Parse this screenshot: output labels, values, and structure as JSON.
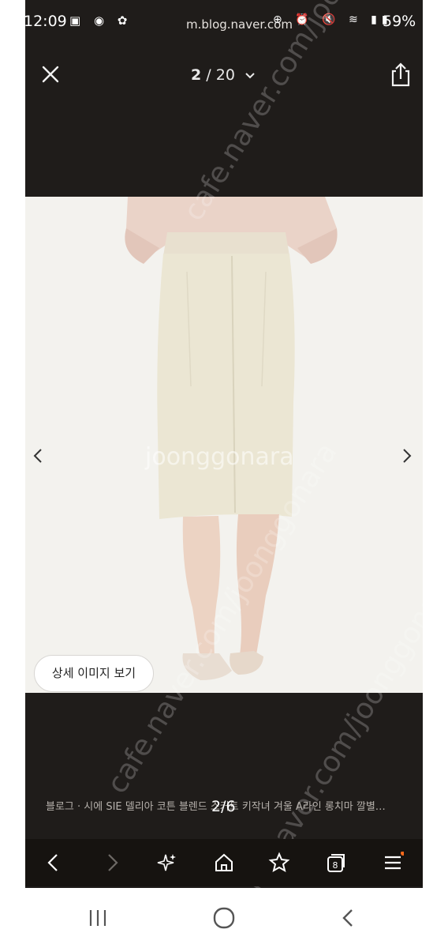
{
  "status": {
    "time": "12:09",
    "url": "m.blog.naver.com",
    "battery": "59%"
  },
  "viewer": {
    "counter_current": "2",
    "counter_sep": "/",
    "counter_total": "20",
    "detail_button": "상세 이미지 보기",
    "watermark_center": "joonggonara",
    "caption": "블로그 · 시에 SIE 델리아 코튼 블렌드 스커트 키작녀 겨울 A라인 롱치마 깔별…",
    "page_indicator": "2/6"
  },
  "watermarks": {
    "diag1": "cafe.naver.com/joonggonara",
    "diag2": "cafe.naver.com/joonggonara",
    "diag3": "cafe.naver.com/joonggonara"
  },
  "icons": {
    "close": "close-icon",
    "share": "share-icon",
    "prev": "chevron-left-icon",
    "next": "chevron-right-icon"
  },
  "colors": {
    "background": "#1f1c1a",
    "photo_bg": "#f3f2ee"
  }
}
